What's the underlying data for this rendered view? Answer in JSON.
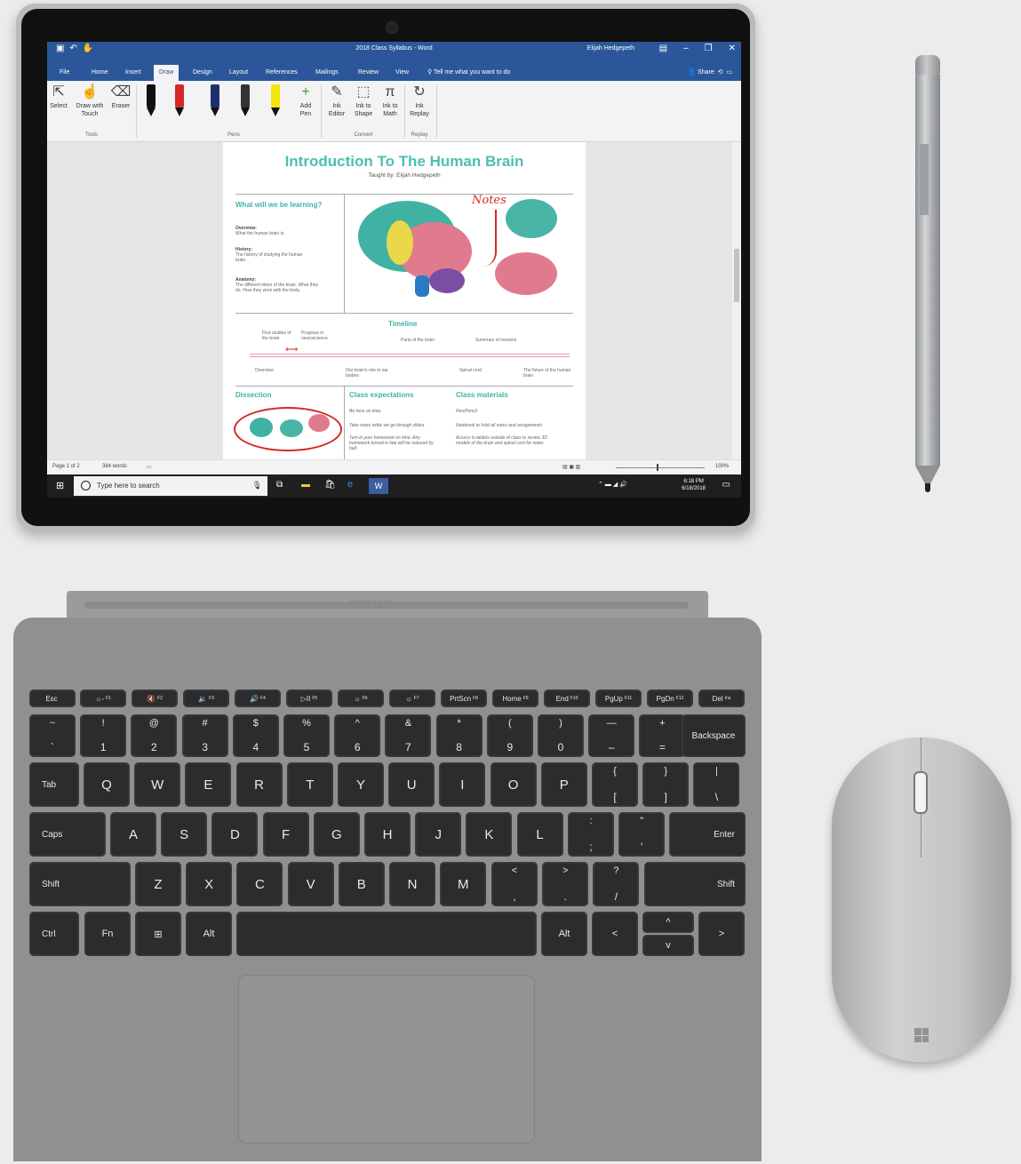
{
  "word": {
    "title": "2018 Class Syllabus - Word",
    "user": "Elijah Hedgepeth",
    "menu_tabs": [
      "File",
      "Home",
      "Insert",
      "Draw",
      "Design",
      "Layout",
      "References",
      "Mailings",
      "Review",
      "View"
    ],
    "active_tab": "Draw",
    "tell_me": "Tell me what you want to do",
    "share": "Share",
    "ribbon": {
      "select": "Select",
      "draw_with_touch": "Draw with Touch",
      "eraser": "Eraser",
      "group_tools": "Tools",
      "group_pens": "Pens",
      "add_pen": "Add Pen",
      "ink_editor": "Ink Editor",
      "ink_to_shape": "Ink to Shape",
      "ink_to_math": "Ink to Math",
      "group_convert": "Convert",
      "ink_replay": "Ink Replay",
      "group_replay": "Replay",
      "pen_colors": [
        "#111111",
        "#d62828",
        "#1b2f6e",
        "#333333",
        "#f5e50a"
      ]
    },
    "document": {
      "title": "Introduction To The Human Brain",
      "subtitle": "Taught by: Elijah Hedgepeth",
      "learning_heading": "What will we be learning?",
      "overview_label": "Overview:",
      "overview_text": "What the human brain is.",
      "history_label": "History:",
      "history_text": "The history of studying the human brain.",
      "anatomy_label": "Anatomy:",
      "anatomy_text": "The different lobes of the brain. What they do. How they work with the body.",
      "annotation": "Notes",
      "timeline_heading": "Timeline",
      "timeline_top": [
        "First studies of the brain",
        "Progress in neuroscience",
        "Parts of the brain",
        "Summary of neurons"
      ],
      "timeline_bottom": [
        "Overview",
        "Our brain's role in our bodies",
        "Spinal cord",
        "The future of the human brain"
      ],
      "dissection_heading": "Dissection",
      "expectations_heading": "Class expectations",
      "expectations": [
        "Be here on time.",
        "Take notes while we go through slides.",
        "Turn in your homework on time. Any homework turned in late will be reduced by half."
      ],
      "materials_heading": "Class materials",
      "materials": [
        "Pen/Pencil",
        "Notebook to hold all notes and assignments",
        "Access to tablets outside of class to review 3D models of the brain and spinal cord for notes"
      ]
    },
    "status": {
      "page": "Page 1 of 2",
      "words": "384 words",
      "zoom": "100%"
    }
  },
  "taskbar": {
    "search_placeholder": "Type here to search",
    "time": "6:18 PM",
    "date": "6/18/2018"
  },
  "keyboard": {
    "fn_row": [
      {
        "main": "Esc",
        "sub": ""
      },
      {
        "main": "☼-",
        "sub": "F1"
      },
      {
        "main": "🔇",
        "sub": "F2"
      },
      {
        "main": "🔉",
        "sub": "F3"
      },
      {
        "main": "🔊",
        "sub": "F4"
      },
      {
        "main": "▷II",
        "sub": "F5"
      },
      {
        "main": "☼",
        "sub": "F6"
      },
      {
        "main": "☼",
        "sub": "F7"
      },
      {
        "main": "PrtScn",
        "sub": "F8"
      },
      {
        "main": "Home",
        "sub": "F9"
      },
      {
        "main": "End",
        "sub": "F10"
      },
      {
        "main": "PgUp",
        "sub": "F11"
      },
      {
        "main": "PgDn",
        "sub": "F12"
      },
      {
        "main": "Del",
        "sub": "Ins"
      }
    ],
    "num_row": [
      {
        "up": "~",
        "dn": "`"
      },
      {
        "up": "!",
        "dn": "1"
      },
      {
        "up": "@",
        "dn": "2"
      },
      {
        "up": "#",
        "dn": "3"
      },
      {
        "up": "$",
        "dn": "4"
      },
      {
        "up": "%",
        "dn": "5"
      },
      {
        "up": "^",
        "dn": "6"
      },
      {
        "up": "&",
        "dn": "7"
      },
      {
        "up": "*",
        "dn": "8"
      },
      {
        "up": "(",
        "dn": "9"
      },
      {
        "up": ")",
        "dn": "0"
      },
      {
        "up": "—",
        "dn": "–"
      },
      {
        "up": "+",
        "dn": "="
      }
    ],
    "backspace": "Backspace",
    "tab": "Tab",
    "qwerty": [
      "Q",
      "W",
      "E",
      "R",
      "T",
      "Y",
      "U",
      "I",
      "O",
      "P"
    ],
    "brackets": [
      {
        "up": "{",
        "dn": "["
      },
      {
        "up": "}",
        "dn": "]"
      },
      {
        "up": "|",
        "dn": "\\"
      }
    ],
    "caps": "Caps",
    "asdf": [
      "A",
      "S",
      "D",
      "F",
      "G",
      "H",
      "J",
      "K",
      "L"
    ],
    "semi": [
      {
        "up": ":",
        "dn": ";"
      },
      {
        "up": "\"",
        "dn": "'"
      }
    ],
    "enter": "Enter",
    "shift": "Shift",
    "zxcv": [
      "Z",
      "X",
      "C",
      "V",
      "B",
      "N",
      "M"
    ],
    "punct": [
      {
        "up": "<",
        "dn": ","
      },
      {
        "up": ">",
        "dn": "."
      },
      {
        "up": "?",
        "dn": "/"
      }
    ],
    "ctrl": "Ctrl",
    "fn": "Fn",
    "alt": "Alt",
    "arrow_left": "<",
    "arrow_up": "^",
    "arrow_down": "v",
    "arrow_right": ">"
  }
}
